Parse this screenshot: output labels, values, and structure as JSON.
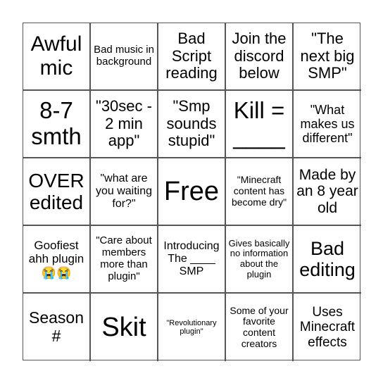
{
  "cells": [
    {
      "text": "Awful mic",
      "size": 30
    },
    {
      "text": "Bad music in background",
      "size": 15
    },
    {
      "text": "Bad Script reading",
      "size": 22
    },
    {
      "text": "Join the discord below",
      "size": 22
    },
    {
      "text": "\"The next big SMP\"",
      "size": 22
    },
    {
      "text": "8-7 smth",
      "size": 33
    },
    {
      "text": "\"30sec - 2 min app\"",
      "size": 22
    },
    {
      "text": "\"Smp sounds stupid\"",
      "size": 22
    },
    {
      "text": "Kill = ____",
      "size": 33
    },
    {
      "text": "\"What makes us different\"",
      "size": 18
    },
    {
      "text": "OVER edited",
      "size": 28
    },
    {
      "text": "\"what are you waiting for?\"",
      "size": 16
    },
    {
      "text": "Free",
      "size": 38
    },
    {
      "text": "\"Minecraft content has become dry\"",
      "size": 14
    },
    {
      "text": "Made by an 8 year old",
      "size": 21
    },
    {
      "text": "Goofiest ahh plugin 😭😭",
      "size": 17
    },
    {
      "text": "\"Care about members more than plugin\"",
      "size": 15
    },
    {
      "text": "Introducing The ____ SMP",
      "size": 16
    },
    {
      "text": "Gives basically no information about the plugin",
      "size": 13
    },
    {
      "text": "Bad editing",
      "size": 27
    },
    {
      "text": "Season #",
      "size": 23
    },
    {
      "text": "Skit",
      "size": 38
    },
    {
      "text": "\"Revolutionary plugin\"",
      "size": 11
    },
    {
      "text": "Some of your favorite content creators",
      "size": 14
    },
    {
      "text": "Uses Minecraft effects",
      "size": 19
    }
  ]
}
